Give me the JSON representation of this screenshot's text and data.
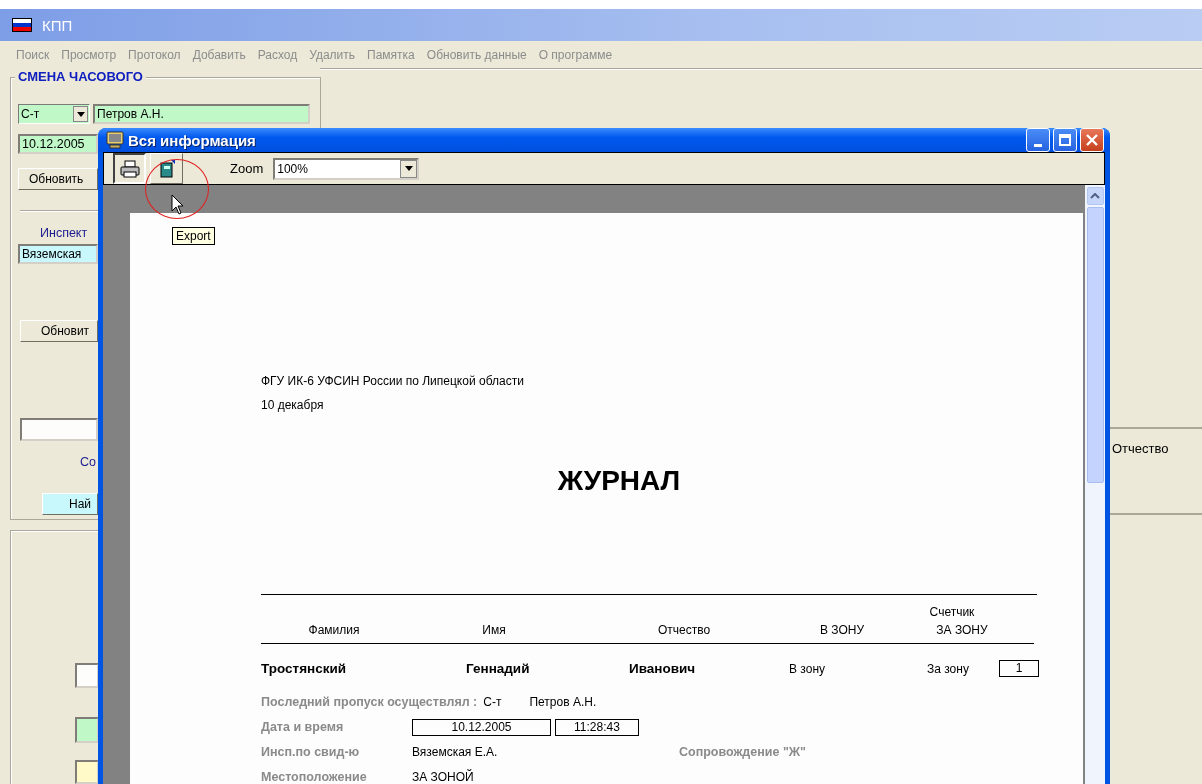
{
  "window": {
    "title": "КПП"
  },
  "menu": [
    {
      "label": "Поиск",
      "disabled": true
    },
    {
      "label": "Просмотр",
      "disabled": true
    },
    {
      "label": "Протокол",
      "disabled": true
    },
    {
      "label": "Добавить",
      "disabled": true
    },
    {
      "label": "Расход",
      "disabled": true
    },
    {
      "label": "Удалить",
      "disabled": true
    },
    {
      "label": "Памятка",
      "disabled": true
    },
    {
      "label": "Обновить данные",
      "disabled": true
    },
    {
      "label": "О программе",
      "disabled": true
    }
  ],
  "shift_panel": {
    "title": "СМЕНА ЧАСОВОГО",
    "rank": "С-т",
    "guard": "Петров А.Н.",
    "date": "10.12.2005",
    "refresh_button": "Обновить",
    "inspector_label": "Инспект",
    "inspector": "Вяземская",
    "refresh_button_2": "Обновит",
    "escort_label": "Со",
    "find_button": "Най"
  },
  "right_panel": {
    "column_label": "Отчество"
  },
  "dialog": {
    "title": "Вся информация",
    "zoom_label": "Zoom",
    "zoom_value": "100%",
    "tooltip": "Export",
    "report": {
      "organization": "ФГУ ИК-6 УФСИН России по Липецкой области",
      "date": "10 декабря",
      "title": "ЖУРНАЛ",
      "columns": [
        "Фамилия",
        "Имя",
        "Отчество"
      ],
      "counter": {
        "title": "Счетчик",
        "columns": [
          "В ЗОНУ",
          "ЗА ЗОНУ"
        ]
      },
      "record": {
        "last_name": "Тростянский",
        "first_name": "Геннадий",
        "patronymic": "Иванович",
        "in_zone": "В зону",
        "out_zone": "За зону",
        "count": "1",
        "last_pass_label": "Последний пропуск осуществлял :",
        "last_pass_rank": "С-т",
        "last_pass_name": "Петров А.Н.",
        "datetime_label": "Дата и время",
        "date": "10.12.2005",
        "time": "11:28:43",
        "inspector_label": "Инсп.по свид-ю",
        "inspector": "Вяземская Е.А.",
        "escort_label": "Сопровождение \"Ж\"",
        "location_label": "Местоположение",
        "location": "ЗА ЗОНОЙ"
      }
    }
  }
}
